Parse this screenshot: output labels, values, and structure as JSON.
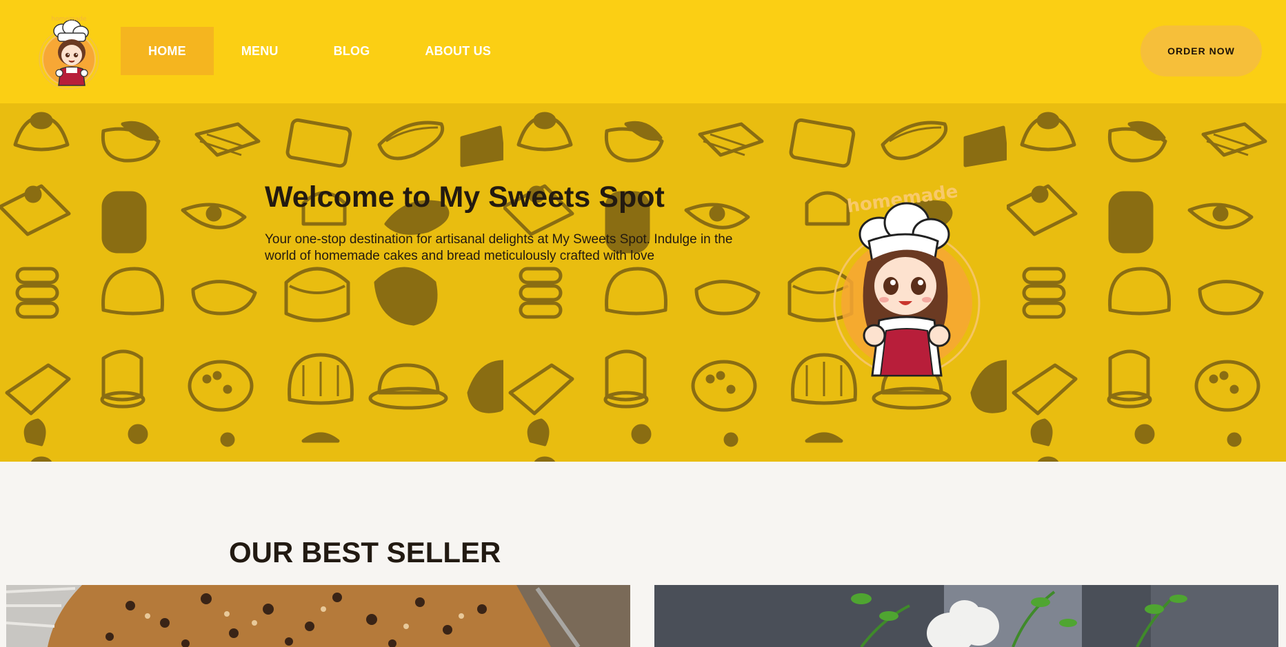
{
  "brand": {
    "logo_icon": "chef-girl-logo",
    "logo_text": "homemade"
  },
  "nav": {
    "items": [
      {
        "label": "HOME",
        "active": true
      },
      {
        "label": "MENU",
        "active": false
      },
      {
        "label": "BLOG",
        "active": false
      },
      {
        "label": "ABOUT US",
        "active": false
      }
    ],
    "order_label": "ORDER NOW"
  },
  "hero": {
    "title": "Welcome to My Sweets Spot",
    "subtitle": "Your one-stop destination for artisanal delights at My Sweets Spot. Indulge in the world of homemade cakes and bread meticulously crafted with love",
    "mascot_icon": "chef-girl-mascot",
    "mascot_text": "homemade",
    "pattern_icon": "pastry-pattern"
  },
  "bestseller": {
    "title": "OUR BEST SELLER",
    "items": [
      {
        "image": "chocolate-chip-cake-photo"
      },
      {
        "image": "white-flower-cake-photo"
      }
    ]
  },
  "colors": {
    "header_bg": "#fbcf14",
    "hero_bg": "#e9bd10",
    "nav_active": "#f5b51f",
    "button_bg": "#f6bf3a",
    "pattern": "#8a6d12",
    "page_bg": "#f7f5f2"
  }
}
